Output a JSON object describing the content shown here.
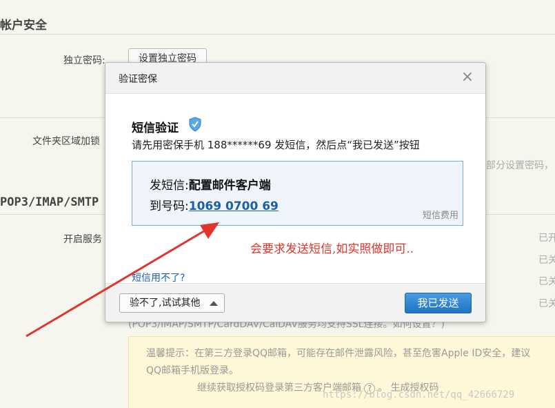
{
  "background": {
    "section_account": "帐户安全",
    "independent_pw_label": "独立密码:",
    "independent_pw_button": "设置独立密码",
    "folder_lock_label": "文件夹区域加锁",
    "folder_lock_note": "部分设置密码，",
    "section_pop": "POP3/IMAP/SMTP",
    "enable_service_label": "开启服务",
    "service_statuses": [
      "已开",
      "已关",
      "已关",
      "已关"
    ],
    "ssl_note": "(POP3/IMAP/SMTP/CardDAV/CalDAV服务均支持SSL连接。如何设置？)",
    "tip_line1": "温馨提示：在第三方登录QQ邮箱，可能存在邮件泄露风险，甚至危害Apple ID安全，建议",
    "tip_line2": "QQ邮箱手机版登录。",
    "tip_line3_a": "继续获取授权码登录第三方客户端邮箱",
    "tip_line3_b": "。 生成授权码",
    "watermark": "https://blog.csdn.net/qq_42666729"
  },
  "modal": {
    "title": "验证密保",
    "close": "×",
    "sms_heading": "短信验证",
    "shield_icon": "shield-check-icon",
    "instruction": "请先用密保手机 188******69 发短信，然后点“我已发送”按钮",
    "send_label": "发短信:",
    "send_value": "配置邮件客户端",
    "to_label": "到号码:",
    "to_value": "1069 0700 69",
    "fee_link": "短信费用",
    "annotation": "会要求发送短信,如实照做即可..",
    "help_link": "短信用不了?",
    "alt_button": "验不了,试试其他",
    "sent_button": "我已发送"
  },
  "colors": {
    "accent_blue": "#1f72c4",
    "annotation_red": "#e0342c",
    "box_border": "#6fb0de"
  }
}
